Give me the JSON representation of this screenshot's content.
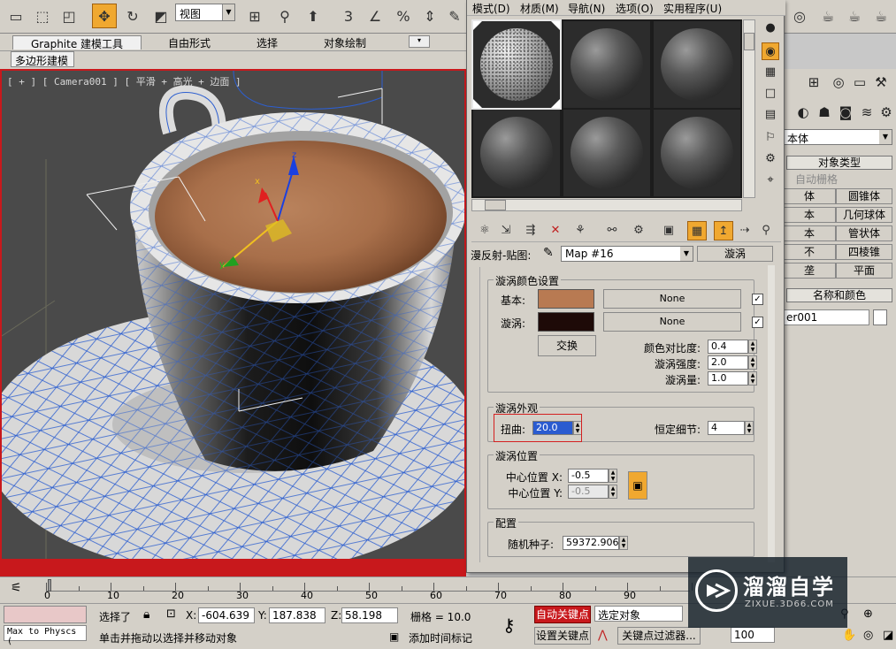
{
  "toolbar": {
    "view_select": "视图"
  },
  "ribbon": {
    "tabs": [
      "Graphite 建模工具",
      "自由形式",
      "选择",
      "对象绘制"
    ],
    "sub_tab": "多边形建模"
  },
  "viewport": {
    "label": "[ + ] [ Camera001 ] [ 平滑 + 高光 + 边面 ]"
  },
  "material_editor": {
    "menu": [
      "模式(D)",
      "材质(M)",
      "导航(N)",
      "选项(O)",
      "实用程序(U)"
    ],
    "map_label": "漫反射-贴图:",
    "map_name": "Map #16",
    "map_type": "漩涡",
    "swirl_color_group": {
      "title": "漩涡颜色设置",
      "base_label": "基本:",
      "swirl_label": "漩涡:",
      "base_color": "#b87a52",
      "swirl_color": "#1e0a08",
      "base_map": "None",
      "swirl_map": "None",
      "swap_label": "交换",
      "contrast_label": "颜色对比度:",
      "contrast_value": "0.4",
      "intensity_label": "漩涡强度:",
      "intensity_value": "2.0",
      "amount_label": "漩涡量:",
      "amount_value": "1.0"
    },
    "swirl_appearance_group": {
      "title": "漩涡外观",
      "twist_label": "扭曲:",
      "twist_value": "20.0",
      "detail_label": "恒定细节:",
      "detail_value": "4"
    },
    "swirl_location_group": {
      "title": "漩涡位置",
      "center_x_label": "中心位置 X:",
      "center_x_value": "-0.5",
      "center_y_label": "中心位置 Y:",
      "center_y_value": "-0.5"
    },
    "config_group": {
      "title": "配置",
      "seed_label": "随机种子:",
      "seed_value": "59372.906"
    }
  },
  "command_panel": {
    "category": "本体",
    "object_type_title": "对象类型",
    "auto_grid": "自动栅格",
    "objects": [
      "体",
      "圆锥体",
      "本",
      "几何球体",
      "本",
      "管状体",
      "不",
      "四棱锥",
      "垄",
      "平面"
    ],
    "name_color_title": "名称和颜色",
    "object_name": "er001"
  },
  "timeline": {
    "numbers": [
      "0",
      "10",
      "20",
      "30",
      "40",
      "50",
      "60",
      "70",
      "80",
      "90"
    ]
  },
  "status": {
    "script_listener": "Max to Physcs (",
    "selection": "选择了",
    "x_label": "X:",
    "x_value": "-604.639",
    "y_label": "Y:",
    "y_value": "187.838",
    "z_label": "Z:",
    "z_value": "58.198",
    "grid": "栅格 = 10.0",
    "prompt": "单击并拖动以选择并移动对象",
    "add_time_tag": "添加时间标记",
    "auto_key": "自动关键点",
    "set_key": "设置关键点",
    "selected_object": "选定对象",
    "key_filters": "关键点过滤器...",
    "frame": "100"
  },
  "watermark": {
    "text": "溜溜自学",
    "url": "ZIXUE.3D66.COM"
  }
}
